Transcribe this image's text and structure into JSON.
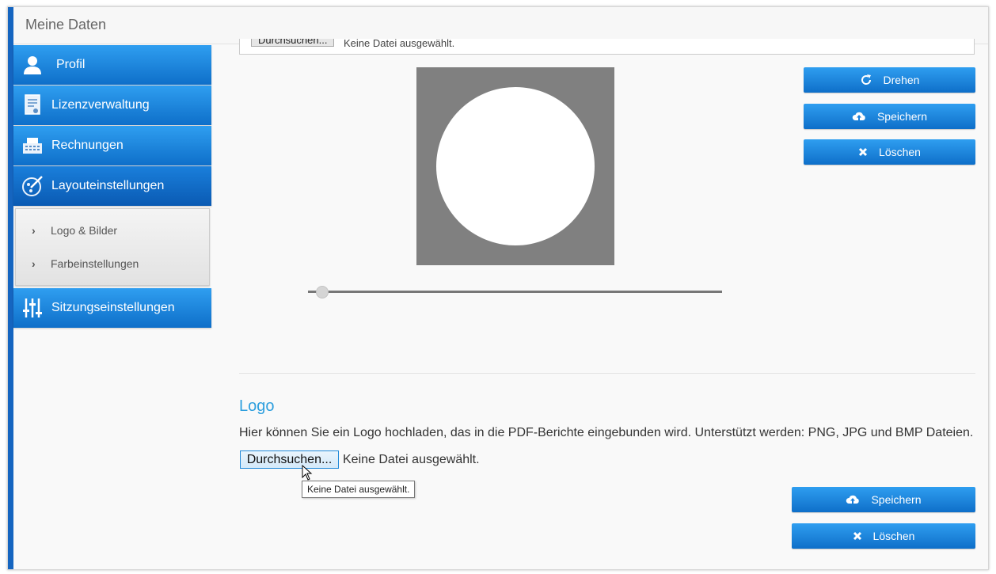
{
  "window": {
    "title": "Meine Daten"
  },
  "sidebar": {
    "items": [
      {
        "label": "Profil",
        "icon": "user-icon"
      },
      {
        "label": "Lizenzverwaltung",
        "icon": "certificate-icon"
      },
      {
        "label": "Rechnungen",
        "icon": "cash-register-icon"
      },
      {
        "label": "Layouteinstellungen",
        "icon": "palette-icon",
        "active": true
      },
      {
        "label": "Sitzungseinstellungen",
        "icon": "sliders-icon"
      }
    ],
    "submenu": [
      {
        "label": "Logo & Bilder"
      },
      {
        "label": "Farbeinstellungen"
      }
    ]
  },
  "image_section": {
    "file_button": "Durchsuchen...",
    "file_status": "Keine Datei ausgewählt.",
    "rotate_label": "Drehen",
    "save_label": "Speichern",
    "delete_label": "Löschen",
    "zoom_level": 0.02
  },
  "logo_section": {
    "heading": "Logo",
    "description": "Hier können Sie ein Logo hochladen, das in die PDF-Berichte eingebunden wird. Unterstützt werden: PNG, JPG und BMP Dateien.",
    "file_button": "Durchsuchen...",
    "file_status": "Keine Datei ausgewählt.",
    "tooltip": "Keine Datei ausgewählt.",
    "save_label": "Speichern",
    "delete_label": "Löschen"
  },
  "colors": {
    "accent": "#1565c0",
    "button": "#1a86df",
    "heading": "#2e9fde"
  }
}
